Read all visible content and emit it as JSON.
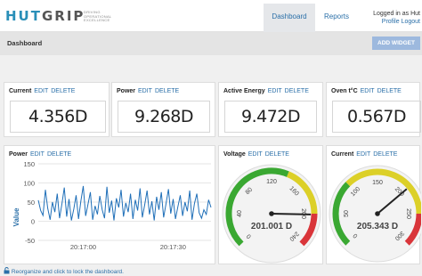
{
  "header": {
    "logo_part1": "HUT",
    "logo_part2": "GRIP",
    "tagline_line1": "DRIVING",
    "tagline_line2": "OPERATIONAL",
    "tagline_line3": "EXCELLENCE",
    "tabs": [
      {
        "label": "Dashboard"
      },
      {
        "label": "Reports"
      }
    ],
    "user": {
      "logged_in_text": "Logged in as Hut",
      "profile_label": "Profile",
      "logout_label": "Logout"
    }
  },
  "subheader": {
    "title": "Dashboard",
    "add_widget_label": "ADD WIDGET"
  },
  "widget_actions": {
    "edit": "EDIT",
    "delete": "DELETE"
  },
  "value_widgets": [
    {
      "title": "Current",
      "value": "4.356D"
    },
    {
      "title": "Power",
      "value": "9.268D"
    },
    {
      "title": "Active Energy",
      "value": "9.472D"
    },
    {
      "title": "Oven t°C",
      "value": "0.567D"
    }
  ],
  "power_chart_widget": {
    "title": "Power"
  },
  "voltage_gauge": {
    "title": "Voltage",
    "value": 201.001,
    "display": "201.001 D",
    "min": 0,
    "max": 240,
    "tick_labels": [
      "0",
      "40",
      "80",
      "120",
      "160",
      "200",
      "240"
    ]
  },
  "current_gauge": {
    "title": "Current",
    "value": 205.343,
    "display": "205.343 D",
    "min": 0,
    "max": 300,
    "tick_labels": [
      "0",
      "50",
      "100",
      "150",
      "200",
      "250",
      "300"
    ]
  },
  "footer": {
    "text": "Reorganize and click to lock the dashboard."
  },
  "colors": {
    "accent": "#2a6fa8",
    "logo": "#2a8fb8",
    "series": "#1f6fb8",
    "gauge_green": "#3aa832",
    "gauge_yellow": "#dcd028",
    "gauge_red": "#d9353a"
  },
  "chart_data": {
    "type": "line",
    "ylabel": "Value",
    "ylim": [
      -50,
      150
    ],
    "yticks": [
      -50,
      0,
      50,
      100,
      150
    ],
    "xtick_labels": [
      "20:17:00",
      "20:17:30"
    ],
    "series": [
      {
        "values": [
          55,
          28,
          15,
          82,
          34,
          4,
          50,
          24,
          72,
          8,
          46,
          88,
          12,
          58,
          2,
          32,
          68,
          6,
          52,
          92,
          14,
          44,
          76,
          4,
          40,
          18,
          66,
          30,
          8,
          90,
          22,
          54,
          2,
          60,
          36,
          82,
          12,
          48,
          24,
          72,
          6,
          56,
          28,
          86,
          10,
          44,
          80,
          18,
          52,
          2,
          64,
          30,
          76,
          10,
          46,
          84,
          20,
          58,
          6,
          38,
          68,
          14,
          50,
          26,
          80,
          4,
          46,
          72,
          22,
          8,
          30,
          18,
          56,
          36
        ]
      }
    ]
  }
}
